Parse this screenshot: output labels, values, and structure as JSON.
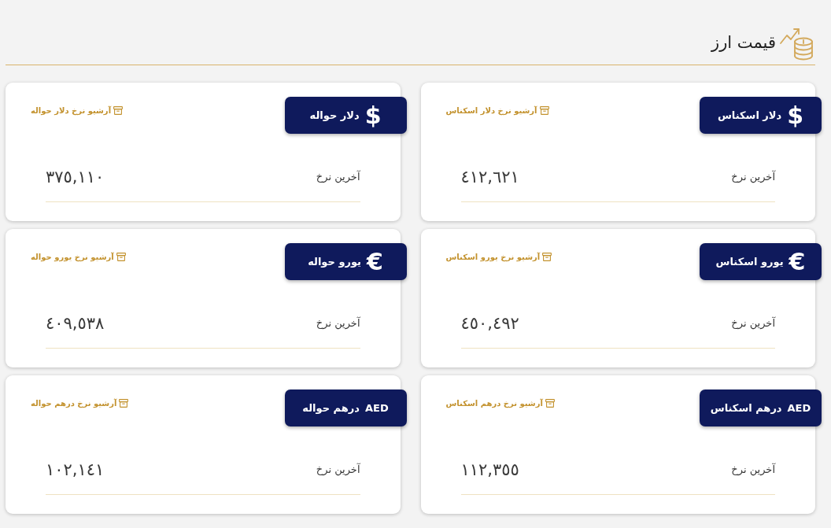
{
  "header": {
    "title": "قیمت ارز"
  },
  "cards": [
    {
      "name": "دلار اسکناس",
      "symbol": {
        "text": "$",
        "kind": "sign"
      },
      "archive_link": "آرشیو نرخ دلار اسکناس",
      "rate_label": "آخرین نرخ",
      "rate": "٤١٢,٦٢١"
    },
    {
      "name": "دلار حواله",
      "symbol": {
        "text": "$",
        "kind": "sign"
      },
      "archive_link": "آرشیو نرخ دلار حواله",
      "rate_label": "آخرین نرخ",
      "rate": "٣٧٥,١١٠"
    },
    {
      "name": "یورو اسکناس",
      "symbol": {
        "text": "€",
        "kind": "sign"
      },
      "archive_link": "آرشیو نرخ یورو اسکناس",
      "rate_label": "آخرین نرخ",
      "rate": "٤٥٠,٤٩٢"
    },
    {
      "name": "یورو حواله",
      "symbol": {
        "text": "€",
        "kind": "sign"
      },
      "archive_link": "آرشیو نرخ یورو حواله",
      "rate_label": "آخرین نرخ",
      "rate": "٤٠٩,٥٣٨"
    },
    {
      "name": "درهم اسکناس",
      "symbol": {
        "text": "AED",
        "kind": "code"
      },
      "archive_link": "آرشیو نرخ درهم اسکناس",
      "rate_label": "آخرین نرخ",
      "rate": "١١٢,٣٥٥"
    },
    {
      "name": "درهم حواله",
      "symbol": {
        "text": "AED",
        "kind": "code"
      },
      "archive_link": "آرشیو نرخ درهم حواله",
      "rate_label": "آخرین نرخ",
      "rate": "١٠٢,١٤١"
    }
  ]
}
